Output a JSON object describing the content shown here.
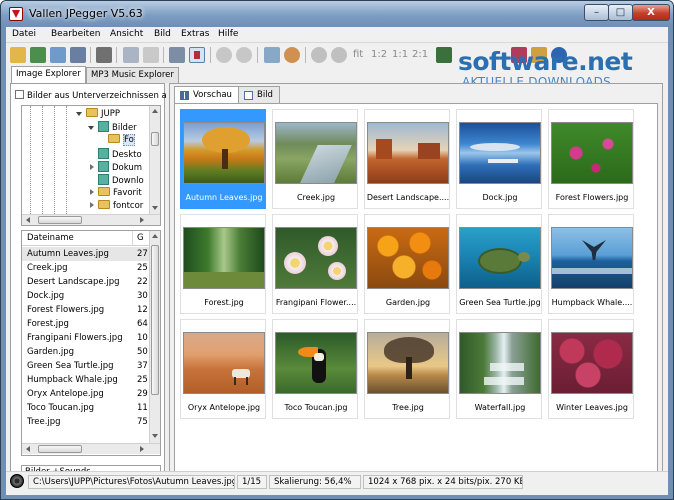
{
  "window": {
    "title": "Vallen JPegger V5.63",
    "min_label": "–",
    "max_label": "□",
    "close_label": "X"
  },
  "menu": [
    "Datei",
    "Bearbeiten",
    "Ansicht",
    "Bild",
    "Extras",
    "Hilfe"
  ],
  "toolbar": {
    "zoom_labels": [
      "fit",
      "1:2",
      "1:1",
      "2:1"
    ]
  },
  "watermark": {
    "brand": "software.net",
    "subtitle": "AKTUELLE DOWNLOADS"
  },
  "left_tabs": [
    "Image Explorer",
    "MP3 Music Explorer"
  ],
  "include_subfolders_label": "Bilder aus Unterverzeichnissen a",
  "tree": [
    {
      "label": "JUPP",
      "type": "folder",
      "expanded": true
    },
    {
      "label": "Bilder",
      "type": "library",
      "expanded": true
    },
    {
      "label": "Fo",
      "type": "folder",
      "selected": true
    },
    {
      "label": "Deskto",
      "type": "library"
    },
    {
      "label": "Dokum",
      "type": "library"
    },
    {
      "label": "Downlo",
      "type": "library"
    },
    {
      "label": "Favorit",
      "type": "folder"
    },
    {
      "label": "fontcor",
      "type": "folder"
    }
  ],
  "file_list": {
    "columns": [
      "Dateiname",
      "G"
    ],
    "rows": [
      {
        "name": "Autumn Leaves.jpg",
        "size": "27"
      },
      {
        "name": "Creek.jpg",
        "size": "25"
      },
      {
        "name": "Desert Landscape.jpg",
        "size": "22"
      },
      {
        "name": "Dock.jpg",
        "size": "30"
      },
      {
        "name": "Forest Flowers.jpg",
        "size": "12"
      },
      {
        "name": "Forest.jpg",
        "size": "64"
      },
      {
        "name": "Frangipani Flowers.jpg",
        "size": "10"
      },
      {
        "name": "Garden.jpg",
        "size": "50"
      },
      {
        "name": "Green Sea Turtle.jpg",
        "size": "37"
      },
      {
        "name": "Humpback Whale.jpg",
        "size": "25"
      },
      {
        "name": "Oryx Antelope.jpg",
        "size": "29"
      },
      {
        "name": "Toco Toucan.jpg",
        "size": "11"
      },
      {
        "name": "Tree.jpg",
        "size": "75"
      }
    ]
  },
  "filter_dropdown": "Bilder +Sounds",
  "right_tabs": [
    "Vorschau",
    "Bild"
  ],
  "thumbnails": [
    {
      "label": "Autumn Leaves.jpg",
      "theme": "autumn",
      "selected": true
    },
    {
      "label": "Creek.jpg",
      "theme": "creek"
    },
    {
      "label": "Desert Landscape....",
      "theme": "desert"
    },
    {
      "label": "Dock.jpg",
      "theme": "dock"
    },
    {
      "label": "Forest Flowers.jpg",
      "theme": "flowers"
    },
    {
      "label": "Forest.jpg",
      "theme": "forest"
    },
    {
      "label": "Frangipani Flower....",
      "theme": "frangipani"
    },
    {
      "label": "Garden.jpg",
      "theme": "garden"
    },
    {
      "label": "Green Sea Turtle.jpg",
      "theme": "turtle"
    },
    {
      "label": "Humpback Whale....",
      "theme": "whale"
    },
    {
      "label": "Oryx Antelope.jpg",
      "theme": "oryx"
    },
    {
      "label": "Toco Toucan.jpg",
      "theme": "toucan"
    },
    {
      "label": "Tree.jpg",
      "theme": "tree"
    },
    {
      "label": "Waterfall.jpg",
      "theme": "waterfall"
    },
    {
      "label": "Winter Leaves.jpg",
      "theme": "winter"
    }
  ],
  "status": {
    "path": "C:\\Users\\JUPP\\Pictures\\Fotos\\Autumn Leaves.jpg",
    "position": "1/15",
    "scaling": "Skalierung: 56,4%",
    "info": "1024 x 768 pix. x 24 bits/pix. 270 KB"
  }
}
